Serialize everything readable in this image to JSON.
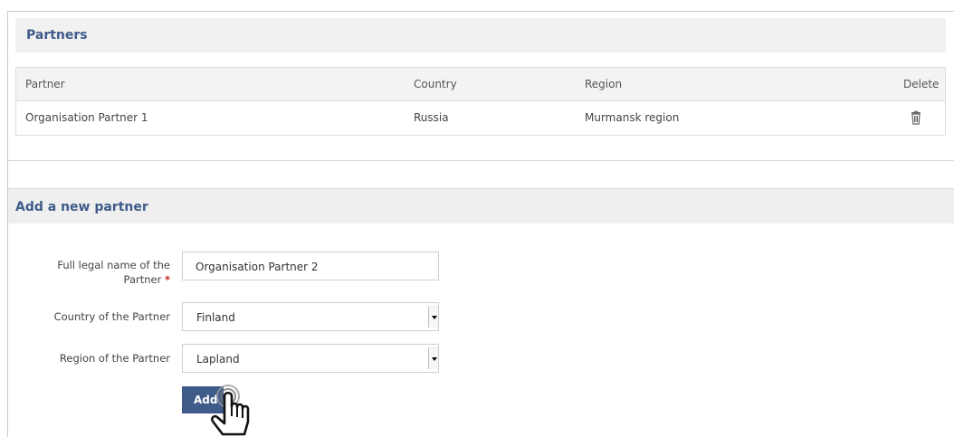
{
  "partners": {
    "title": "Partners",
    "columns": [
      "Partner",
      "Country",
      "Region",
      "Delete"
    ],
    "rows": [
      {
        "partner": "Organisation Partner 1",
        "country": "Russia",
        "region": "Murmansk region",
        "delete_icon": "trash-icon"
      }
    ]
  },
  "add_partner": {
    "title": "Add a new partner",
    "name_label_line1": "Full legal name of the",
    "name_label_line2": "Partner",
    "required_mark": "*",
    "name_value": "Organisation Partner 2",
    "country_label": "Country of the Partner",
    "country_value": "Finland",
    "region_label": "Region of the Partner",
    "region_value": "Lapland",
    "add_button": "Add"
  },
  "colors": {
    "accent": "#3e5b8a",
    "header_bg": "#f1f1f1",
    "required": "#cc2222"
  }
}
